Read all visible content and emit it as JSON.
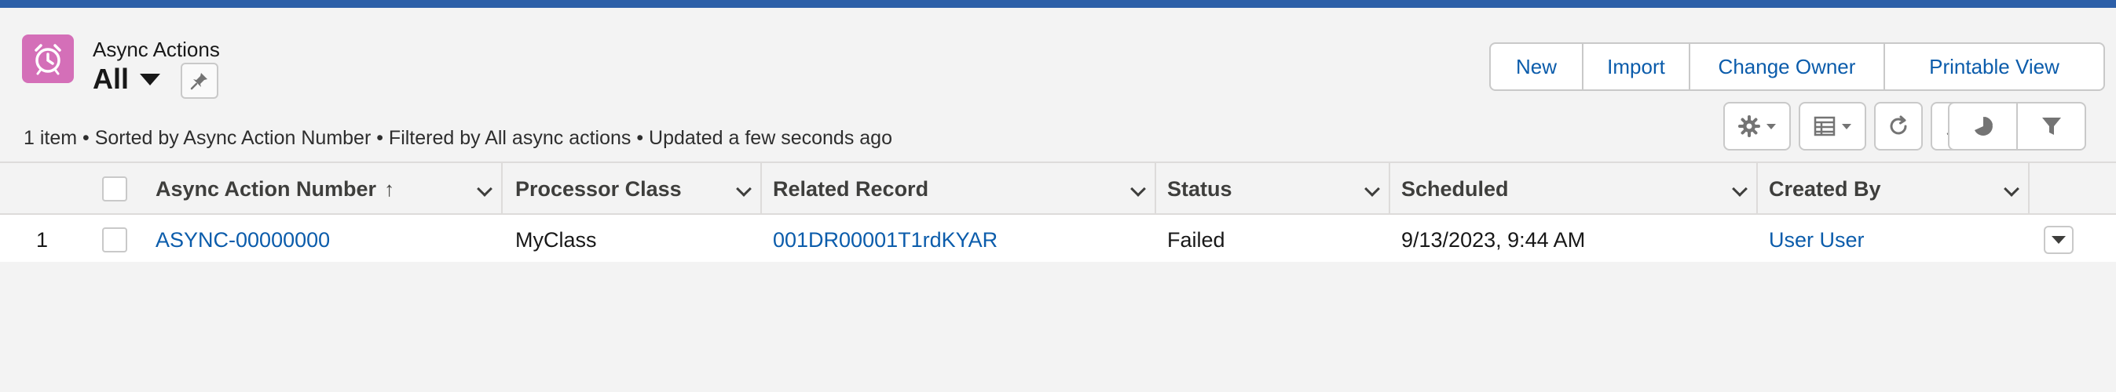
{
  "header": {
    "object_label": "Async Actions",
    "list_view": "All",
    "summary": "1 item • Sorted by Async Action Number • Filtered by All async actions • Updated a few seconds ago"
  },
  "actions": {
    "new": "New",
    "import": "Import",
    "change_owner": "Change Owner",
    "printable_view": "Printable View"
  },
  "toolbar_icons": [
    "gear-icon",
    "table-icon",
    "refresh-icon",
    "pencil-icon",
    "pie-chart-icon",
    "filter-icon"
  ],
  "table": {
    "columns": {
      "number": "Async Action Number",
      "processor": "Processor Class",
      "related": "Related Record",
      "status": "Status",
      "scheduled": "Scheduled",
      "created_by": "Created By"
    },
    "sort_indicator": "↑",
    "rows": [
      {
        "index": "1",
        "number": "ASYNC-00000000",
        "processor": "MyClass",
        "related": "001DR00001T1rdKYAR",
        "status": "Failed",
        "scheduled": "9/13/2023, 9:44 AM",
        "created_by": "User User"
      }
    ]
  },
  "colors": {
    "brand_strip": "#2c5fa8",
    "object_icon": "#d46fb8",
    "link": "#0b5cab"
  }
}
